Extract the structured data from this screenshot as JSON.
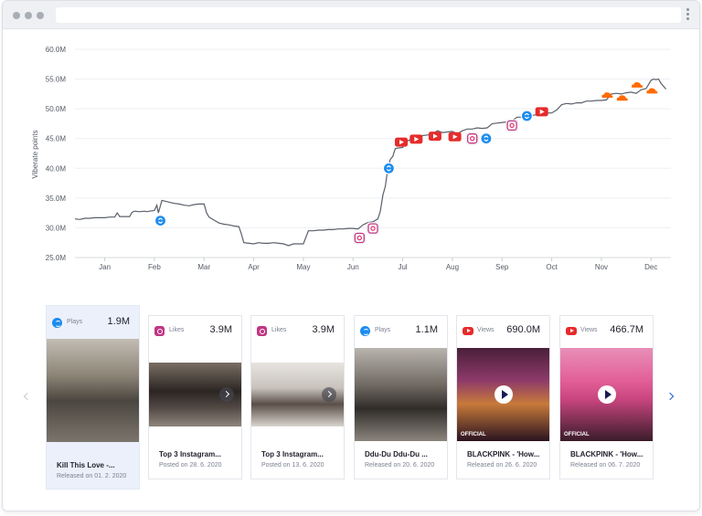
{
  "chart_data": {
    "type": "line",
    "ylabel": "Viberate points",
    "xlabel": "",
    "yticks": [
      "25.0M",
      "30.0M",
      "35.0M",
      "40.0M",
      "45.0M",
      "50.0M",
      "55.0M",
      "60.0M"
    ],
    "ylim": [
      25.0,
      60.0
    ],
    "y_unit": "M",
    "xticks": [
      "Jan",
      "Feb",
      "Mar",
      "Apr",
      "May",
      "Jun",
      "Jul",
      "Aug",
      "Sep",
      "Oct",
      "Nov",
      "Dec"
    ],
    "xlim": [
      -0.6,
      11.4
    ],
    "grid": "horizontal",
    "series_color": "#5a5f69",
    "x": [
      -0.6,
      -0.5,
      -0.4,
      -0.3,
      -0.2,
      -0.1,
      0,
      0.1,
      0.2,
      0.25,
      0.3,
      0.35,
      0.4,
      0.5,
      0.55,
      0.6,
      0.7,
      0.8,
      0.85,
      0.9,
      1.0,
      1.05,
      1.08,
      1.15,
      1.2,
      1.3,
      1.4,
      1.5,
      1.6,
      1.7,
      1.8,
      1.9,
      2.0,
      2.05,
      2.1,
      2.2,
      2.3,
      2.4,
      2.5,
      2.6,
      2.7,
      2.75,
      2.8,
      2.9,
      3.0,
      3.1,
      3.2,
      3.3,
      3.4,
      3.5,
      3.6,
      3.7,
      3.8,
      3.9,
      4.0,
      4.1,
      4.2,
      4.3,
      4.4,
      4.5,
      4.6,
      4.7,
      4.8,
      4.9,
      5.0,
      5.1,
      5.2,
      5.25,
      5.3,
      5.4,
      5.5,
      5.55,
      5.6,
      5.65,
      5.7,
      5.75,
      5.8,
      5.85,
      5.9,
      6.0,
      6.05,
      6.1,
      6.2,
      6.3,
      6.4,
      6.5,
      6.6,
      6.7,
      6.8,
      6.9,
      7.0,
      7.1,
      7.2,
      7.3,
      7.4,
      7.5,
      7.6,
      7.7,
      7.8,
      7.9,
      8.0,
      8.1,
      8.2,
      8.3,
      8.4,
      8.5,
      8.6,
      8.7,
      8.8,
      8.9,
      9.0,
      9.1,
      9.2,
      9.3,
      9.4,
      9.5,
      9.6,
      9.7,
      9.8,
      9.9,
      10.0,
      10.1,
      10.2,
      10.3,
      10.4,
      10.5,
      10.6,
      10.7,
      10.8,
      10.9,
      11.0,
      11.05,
      11.1,
      11.15,
      11.2,
      11.3
    ],
    "values": [
      31.5,
      31.4,
      31.6,
      31.6,
      31.7,
      31.7,
      31.7,
      31.8,
      31.8,
      32.5,
      31.9,
      31.9,
      31.9,
      31.9,
      32.6,
      32.8,
      32.7,
      32.8,
      32.7,
      32.8,
      32.9,
      33.8,
      32.5,
      34.6,
      34.5,
      34.3,
      34.1,
      34.0,
      33.8,
      33.7,
      33.9,
      34.0,
      34.0,
      32.5,
      31.8,
      31.3,
      30.8,
      30.6,
      30.5,
      30.3,
      30.2,
      29.0,
      27.5,
      27.4,
      27.3,
      27.5,
      27.4,
      27.4,
      27.5,
      27.4,
      27.3,
      27.0,
      27.3,
      27.3,
      27.3,
      29.5,
      29.5,
      29.6,
      29.6,
      29.7,
      29.7,
      29.8,
      29.8,
      29.9,
      29.9,
      29.8,
      30.5,
      30.7,
      30.9,
      31.0,
      31.5,
      32.8,
      35.5,
      37.0,
      40.0,
      41.5,
      42.0,
      43.3,
      43.4,
      43.5,
      44.4,
      44.6,
      45.0,
      45.3,
      45.5,
      45.6,
      45.8,
      46.3,
      46.0,
      46.1,
      46.2,
      45.8,
      46.3,
      46.6,
      46.6,
      46.8,
      46.7,
      46.8,
      47.5,
      47.6,
      47.7,
      47.8,
      48.0,
      48.6,
      48.6,
      48.9,
      48.9,
      49.0,
      49.1,
      49.3,
      49.3,
      49.8,
      50.7,
      50.9,
      50.8,
      51.0,
      51.0,
      51.3,
      51.3,
      51.4,
      51.4,
      51.5,
      52.5,
      52.6,
      52.5,
      52.7,
      52.8,
      52.6,
      53.2,
      53.4,
      54.8,
      55.0,
      54.9,
      55.0,
      54.3,
      53.3,
      53.6,
      51.8,
      50.0,
      50.0
    ],
    "markers": [
      {
        "type": "shazam",
        "x": 1.12,
        "y": 31.2
      },
      {
        "type": "instagram",
        "x": 5.13,
        "y": 28.3
      },
      {
        "type": "instagram",
        "x": 5.4,
        "y": 29.9
      },
      {
        "type": "shazam",
        "x": 5.72,
        "y": 40.0
      },
      {
        "type": "youtube",
        "x": 5.97,
        "y": 44.4
      },
      {
        "type": "youtube",
        "x": 6.27,
        "y": 44.9
      },
      {
        "type": "youtube",
        "x": 6.65,
        "y": 45.4
      },
      {
        "type": "youtube",
        "x": 7.05,
        "y": 45.3
      },
      {
        "type": "instagram",
        "x": 7.4,
        "y": 45.0
      },
      {
        "type": "shazam",
        "x": 7.68,
        "y": 45.0
      },
      {
        "type": "instagram",
        "x": 8.2,
        "y": 47.2
      },
      {
        "type": "shazam",
        "x": 8.5,
        "y": 48.8
      },
      {
        "type": "youtube",
        "x": 8.8,
        "y": 49.5
      },
      {
        "type": "soundcloud",
        "x": 10.12,
        "y": 52.3
      },
      {
        "type": "soundcloud",
        "x": 10.42,
        "y": 51.8
      },
      {
        "type": "soundcloud",
        "x": 10.72,
        "y": 54.0
      },
      {
        "type": "soundcloud",
        "x": 11.02,
        "y": 53.0
      }
    ]
  },
  "carousel": {
    "cards": [
      {
        "platform": "shazam",
        "metric": "Plays",
        "value": "1.9M",
        "title": "Kill This Love -...",
        "subtitle": "Released on 01. 2. 2020",
        "selected": true,
        "thumb": "kill-this-love"
      },
      {
        "platform": "instagram",
        "metric": "Likes",
        "value": "3.9M",
        "title": "Top 3 Instagram...",
        "subtitle": "Posted on 28. 6. 2020",
        "selected": false,
        "thumb": "insta-1"
      },
      {
        "platform": "instagram",
        "metric": "Likes",
        "value": "3.9M",
        "title": "Top 3 Instagram...",
        "subtitle": "Posted on 13. 6. 2020",
        "selected": false,
        "thumb": "insta-2"
      },
      {
        "platform": "shazam",
        "metric": "Plays",
        "value": "1.1M",
        "title": "Ddu-Du Ddu-Du ...",
        "subtitle": "Released on 20. 6. 2020",
        "selected": false,
        "thumb": "ddu-du"
      },
      {
        "platform": "youtube",
        "metric": "Views",
        "value": "690.0M",
        "title": "BLACKPINK - 'How...",
        "subtitle": "Released on 26. 6. 2020",
        "selected": false,
        "thumb": "yt-1",
        "badge": "OFFICIAL"
      },
      {
        "platform": "youtube",
        "metric": "Views",
        "value": "466.7M",
        "title": "BLACKPINK - 'How...",
        "subtitle": "Released on 06. 7. 2020",
        "selected": false,
        "thumb": "yt-2",
        "badge": "OFFICIAL"
      }
    ]
  }
}
